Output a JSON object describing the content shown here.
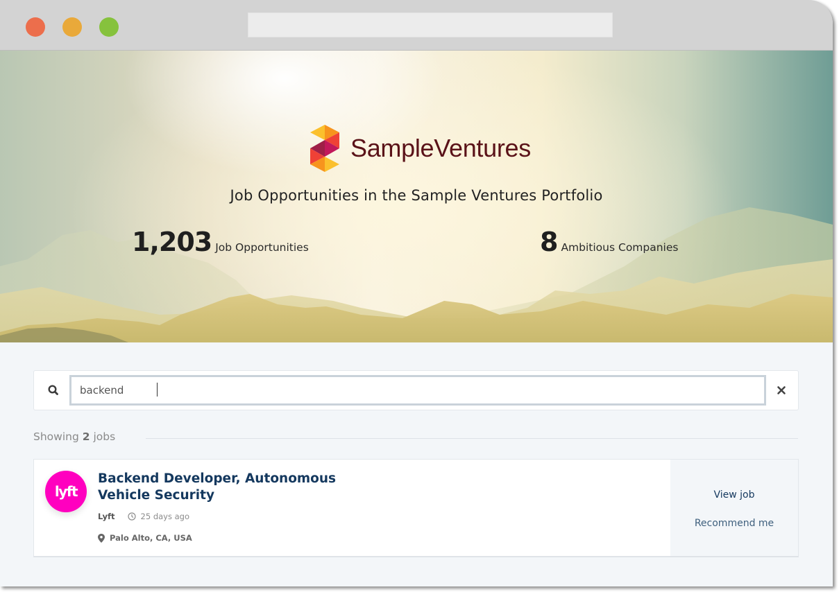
{
  "browser": {
    "controls": [
      "close",
      "minimize",
      "maximize"
    ],
    "address_bar_value": ""
  },
  "hero": {
    "brand_name": "SampleVentures",
    "title": "Job Opportunities in the Sample Ventures Portfolio",
    "stats": [
      {
        "value": "1,203",
        "label": "Job Opportunities"
      },
      {
        "value": "8",
        "label": "Ambitious Companies"
      }
    ]
  },
  "search": {
    "icon": "search-icon",
    "value": "backend",
    "clear_icon": "close-icon"
  },
  "results": {
    "prefix": "Showing",
    "count": "2",
    "suffix": "jobs"
  },
  "jobs": [
    {
      "company_logo_text": "lyft",
      "title": "Backend Developer, Autonomous Vehicle Security",
      "company": "Lyft",
      "posted": "25 days ago",
      "location": "Palo Alto, CA, USA",
      "actions": {
        "view": "View job",
        "recommend": "Recommend me"
      }
    }
  ],
  "colors": {
    "brand_text": "#5a1218",
    "job_title": "#14385e",
    "lyft_pink": "#ff00bf",
    "page_bg": "#f3f6f9"
  }
}
